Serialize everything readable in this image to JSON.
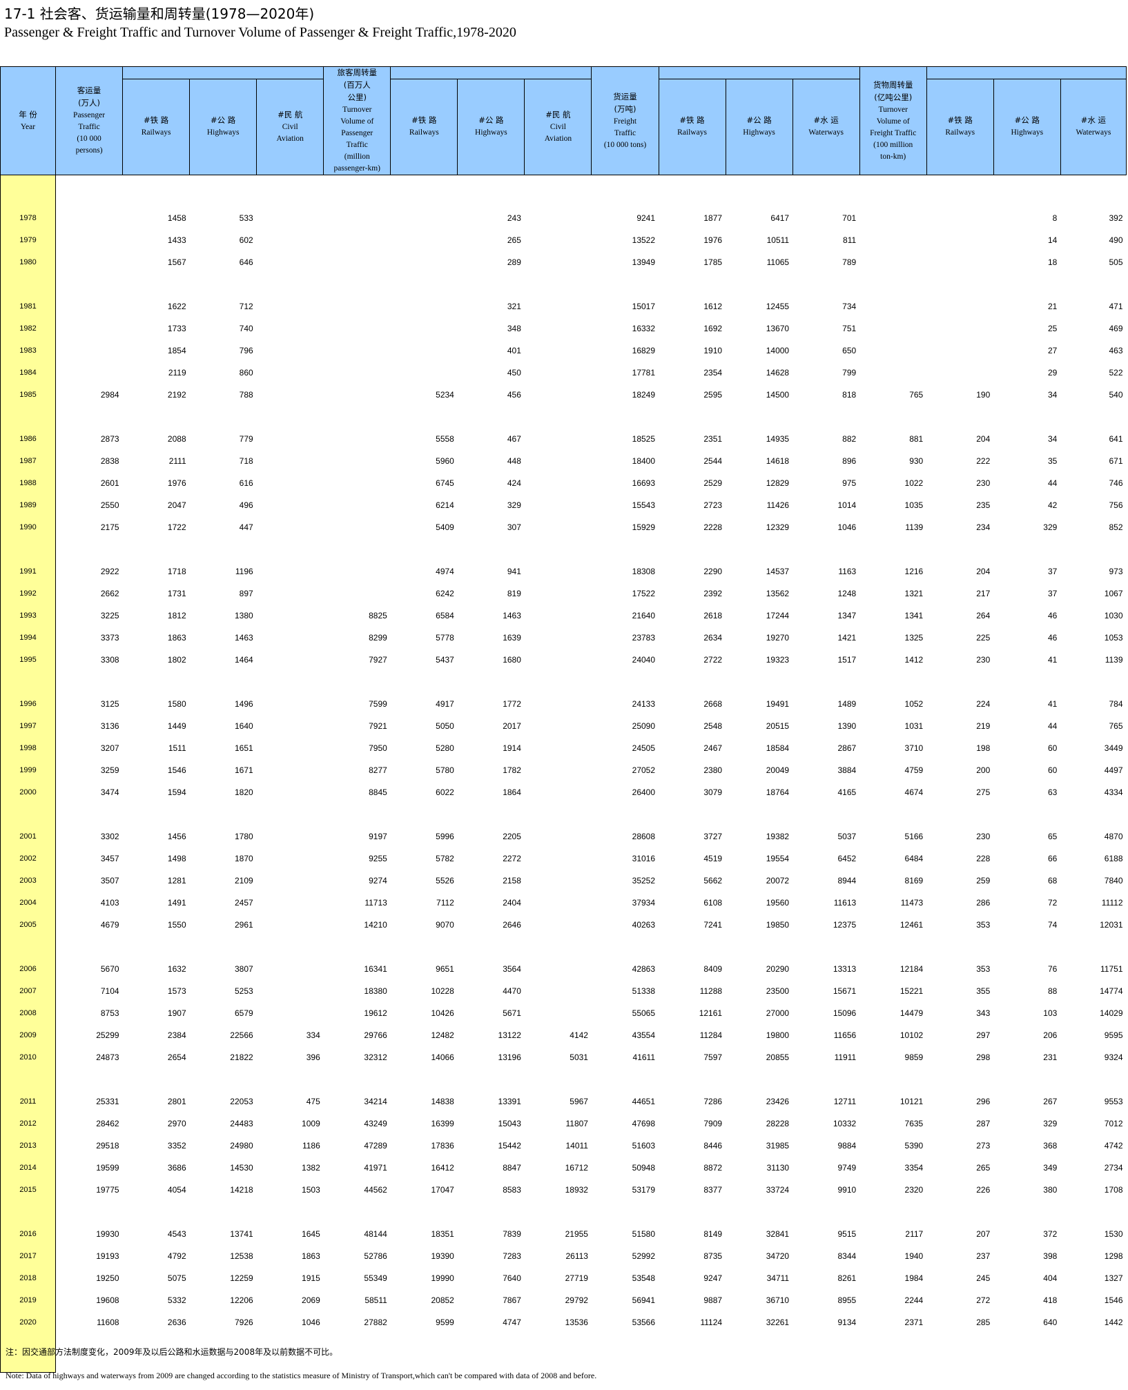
{
  "title_cn": "17-1 社会客、货运输量和周转量(1978—2020年)",
  "title_en": "Passenger & Freight Traffic and Turnover Volume of Passenger & Freight Traffic,1978-2020",
  "headers": {
    "year": [
      "年 份",
      "Year"
    ],
    "pass_traffic": [
      "客运量",
      "(万人)",
      "Passenger",
      "Traffic",
      "(10 000",
      "persons)"
    ],
    "railways": [
      "#铁 路",
      "Railways"
    ],
    "highways": [
      "#公 路",
      "Highways"
    ],
    "civil": [
      "#民 航",
      "Civil",
      "Aviation"
    ],
    "waterways": [
      "#水 运",
      "Waterways"
    ],
    "pass_turnover": [
      "旅客周转量",
      "(百万人",
      "公里)",
      "Turnover",
      "Volume of",
      "Passenger",
      "Traffic",
      "(million",
      "passenger-km)"
    ],
    "freight_traffic": [
      "货运量",
      "(万吨)",
      "Freight",
      "Traffic",
      "(10 000 tons)"
    ],
    "freight_turnover": [
      "货物周转量",
      "(亿吨公里)",
      "Turnover",
      "Volume of",
      "Freight Traffic",
      "(100 million",
      "ton-km)"
    ]
  },
  "rows": [
    [
      "1978",
      "",
      "1458",
      "533",
      "",
      "",
      "",
      "243",
      "",
      "9241",
      "1877",
      "6417",
      "701",
      "",
      "",
      "8",
      "392"
    ],
    [
      "1979",
      "",
      "1433",
      "602",
      "",
      "",
      "",
      "265",
      "",
      "13522",
      "1976",
      "10511",
      "811",
      "",
      "",
      "14",
      "490"
    ],
    [
      "1980",
      "",
      "1567",
      "646",
      "",
      "",
      "",
      "289",
      "",
      "13949",
      "1785",
      "11065",
      "789",
      "",
      "",
      "18",
      "505"
    ],
    [
      "1981",
      "",
      "1622",
      "712",
      "",
      "",
      "",
      "321",
      "",
      "15017",
      "1612",
      "12455",
      "734",
      "",
      "",
      "21",
      "471"
    ],
    [
      "1982",
      "",
      "1733",
      "740",
      "",
      "",
      "",
      "348",
      "",
      "16332",
      "1692",
      "13670",
      "751",
      "",
      "",
      "25",
      "469"
    ],
    [
      "1983",
      "",
      "1854",
      "796",
      "",
      "",
      "",
      "401",
      "",
      "16829",
      "1910",
      "14000",
      "650",
      "",
      "",
      "27",
      "463"
    ],
    [
      "1984",
      "",
      "2119",
      "860",
      "",
      "",
      "",
      "450",
      "",
      "17781",
      "2354",
      "14628",
      "799",
      "",
      "",
      "29",
      "522"
    ],
    [
      "1985",
      "2984",
      "2192",
      "788",
      "",
      "",
      "5234",
      "456",
      "",
      "18249",
      "2595",
      "14500",
      "818",
      "765",
      "190",
      "34",
      "540"
    ],
    [
      "1986",
      "2873",
      "2088",
      "779",
      "",
      "",
      "5558",
      "467",
      "",
      "18525",
      "2351",
      "14935",
      "882",
      "881",
      "204",
      "34",
      "641"
    ],
    [
      "1987",
      "2838",
      "2111",
      "718",
      "",
      "",
      "5960",
      "448",
      "",
      "18400",
      "2544",
      "14618",
      "896",
      "930",
      "222",
      "35",
      "671"
    ],
    [
      "1988",
      "2601",
      "1976",
      "616",
      "",
      "",
      "6745",
      "424",
      "",
      "16693",
      "2529",
      "12829",
      "975",
      "1022",
      "230",
      "44",
      "746"
    ],
    [
      "1989",
      "2550",
      "2047",
      "496",
      "",
      "",
      "6214",
      "329",
      "",
      "15543",
      "2723",
      "11426",
      "1014",
      "1035",
      "235",
      "42",
      "756"
    ],
    [
      "1990",
      "2175",
      "1722",
      "447",
      "",
      "",
      "5409",
      "307",
      "",
      "15929",
      "2228",
      "12329",
      "1046",
      "1139",
      "234",
      "329",
      "852"
    ],
    [
      "1991",
      "2922",
      "1718",
      "1196",
      "",
      "",
      "4974",
      "941",
      "",
      "18308",
      "2290",
      "14537",
      "1163",
      "1216",
      "204",
      "37",
      "973"
    ],
    [
      "1992",
      "2662",
      "1731",
      "897",
      "",
      "",
      "6242",
      "819",
      "",
      "17522",
      "2392",
      "13562",
      "1248",
      "1321",
      "217",
      "37",
      "1067"
    ],
    [
      "1993",
      "3225",
      "1812",
      "1380",
      "",
      "8825",
      "6584",
      "1463",
      "",
      "21640",
      "2618",
      "17244",
      "1347",
      "1341",
      "264",
      "46",
      "1030"
    ],
    [
      "1994",
      "3373",
      "1863",
      "1463",
      "",
      "8299",
      "5778",
      "1639",
      "",
      "23783",
      "2634",
      "19270",
      "1421",
      "1325",
      "225",
      "46",
      "1053"
    ],
    [
      "1995",
      "3308",
      "1802",
      "1464",
      "",
      "7927",
      "5437",
      "1680",
      "",
      "24040",
      "2722",
      "19323",
      "1517",
      "1412",
      "230",
      "41",
      "1139"
    ],
    [
      "1996",
      "3125",
      "1580",
      "1496",
      "",
      "7599",
      "4917",
      "1772",
      "",
      "24133",
      "2668",
      "19491",
      "1489",
      "1052",
      "224",
      "41",
      "784"
    ],
    [
      "1997",
      "3136",
      "1449",
      "1640",
      "",
      "7921",
      "5050",
      "2017",
      "",
      "25090",
      "2548",
      "20515",
      "1390",
      "1031",
      "219",
      "44",
      "765"
    ],
    [
      "1998",
      "3207",
      "1511",
      "1651",
      "",
      "7950",
      "5280",
      "1914",
      "",
      "24505",
      "2467",
      "18584",
      "2867",
      "3710",
      "198",
      "60",
      "3449"
    ],
    [
      "1999",
      "3259",
      "1546",
      "1671",
      "",
      "8277",
      "5780",
      "1782",
      "",
      "27052",
      "2380",
      "20049",
      "3884",
      "4759",
      "200",
      "60",
      "4497"
    ],
    [
      "2000",
      "3474",
      "1594",
      "1820",
      "",
      "8845",
      "6022",
      "1864",
      "",
      "26400",
      "3079",
      "18764",
      "4165",
      "4674",
      "275",
      "63",
      "4334"
    ],
    [
      "2001",
      "3302",
      "1456",
      "1780",
      "",
      "9197",
      "5996",
      "2205",
      "",
      "28608",
      "3727",
      "19382",
      "5037",
      "5166",
      "230",
      "65",
      "4870"
    ],
    [
      "2002",
      "3457",
      "1498",
      "1870",
      "",
      "9255",
      "5782",
      "2272",
      "",
      "31016",
      "4519",
      "19554",
      "6452",
      "6484",
      "228",
      "66",
      "6188"
    ],
    [
      "2003",
      "3507",
      "1281",
      "2109",
      "",
      "9274",
      "5526",
      "2158",
      "",
      "35252",
      "5662",
      "20072",
      "8944",
      "8169",
      "259",
      "68",
      "7840"
    ],
    [
      "2004",
      "4103",
      "1491",
      "2457",
      "",
      "11713",
      "7112",
      "2404",
      "",
      "37934",
      "6108",
      "19560",
      "11613",
      "11473",
      "286",
      "72",
      "11112"
    ],
    [
      "2005",
      "4679",
      "1550",
      "2961",
      "",
      "14210",
      "9070",
      "2646",
      "",
      "40263",
      "7241",
      "19850",
      "12375",
      "12461",
      "353",
      "74",
      "12031"
    ],
    [
      "2006",
      "5670",
      "1632",
      "3807",
      "",
      "16341",
      "9651",
      "3564",
      "",
      "42863",
      "8409",
      "20290",
      "13313",
      "12184",
      "353",
      "76",
      "11751"
    ],
    [
      "2007",
      "7104",
      "1573",
      "5253",
      "",
      "18380",
      "10228",
      "4470",
      "",
      "51338",
      "11288",
      "23500",
      "15671",
      "15221",
      "355",
      "88",
      "14774"
    ],
    [
      "2008",
      "8753",
      "1907",
      "6579",
      "",
      "19612",
      "10426",
      "5671",
      "",
      "55065",
      "12161",
      "27000",
      "15096",
      "14479",
      "343",
      "103",
      "14029"
    ],
    [
      "2009",
      "25299",
      "2384",
      "22566",
      "334",
      "29766",
      "12482",
      "13122",
      "4142",
      "43554",
      "11284",
      "19800",
      "11656",
      "10102",
      "297",
      "206",
      "9595"
    ],
    [
      "2010",
      "24873",
      "2654",
      "21822",
      "396",
      "32312",
      "14066",
      "13196",
      "5031",
      "41611",
      "7597",
      "20855",
      "11911",
      "9859",
      "298",
      "231",
      "9324"
    ],
    [
      "2011",
      "25331",
      "2801",
      "22053",
      "475",
      "34214",
      "14838",
      "13391",
      "5967",
      "44651",
      "7286",
      "23426",
      "12711",
      "10121",
      "296",
      "267",
      "9553"
    ],
    [
      "2012",
      "28462",
      "2970",
      "24483",
      "1009",
      "43249",
      "16399",
      "15043",
      "11807",
      "47698",
      "7909",
      "28228",
      "10332",
      "7635",
      "287",
      "329",
      "7012"
    ],
    [
      "2013",
      "29518",
      "3352",
      "24980",
      "1186",
      "47289",
      "17836",
      "15442",
      "14011",
      "51603",
      "8446",
      "31985",
      "9884",
      "5390",
      "273",
      "368",
      "4742"
    ],
    [
      "2014",
      "19599",
      "3686",
      "14530",
      "1382",
      "41971",
      "16412",
      "8847",
      "16712",
      "50948",
      "8872",
      "31130",
      "9749",
      "3354",
      "265",
      "349",
      "2734"
    ],
    [
      "2015",
      "19775",
      "4054",
      "14218",
      "1503",
      "44562",
      "17047",
      "8583",
      "18932",
      "53179",
      "8377",
      "33724",
      "9910",
      "2320",
      "226",
      "380",
      "1708"
    ],
    [
      "2016",
      "19930",
      "4543",
      "13741",
      "1645",
      "48144",
      "18351",
      "7839",
      "21955",
      "51580",
      "8149",
      "32841",
      "9515",
      "2117",
      "207",
      "372",
      "1530"
    ],
    [
      "2017",
      "19193",
      "4792",
      "12538",
      "1863",
      "52786",
      "19390",
      "7283",
      "26113",
      "52992",
      "8735",
      "34720",
      "8344",
      "1940",
      "237",
      "398",
      "1298"
    ],
    [
      "2018",
      "19250",
      "5075",
      "12259",
      "1915",
      "55349",
      "19990",
      "7640",
      "27719",
      "53548",
      "9247",
      "34711",
      "8261",
      "1984",
      "245",
      "404",
      "1327"
    ],
    [
      "2019",
      "19608",
      "5332",
      "12206",
      "2069",
      "58511",
      "20852",
      "7867",
      "29792",
      "56941",
      "9887",
      "36710",
      "8955",
      "2244",
      "272",
      "418",
      "1546"
    ],
    [
      "2020",
      "11608",
      "2636",
      "7926",
      "1046",
      "27882",
      "9599",
      "4747",
      "13536",
      "53566",
      "11124",
      "32261",
      "9134",
      "2371",
      "285",
      "640",
      "1442"
    ]
  ],
  "note_cn": "注：因交通部方法制度变化，2009年及以后公路和水运数据与2008年及以前数据不可比。",
  "note_en": "Note: Data of highways and waterways from 2009 are changed according to the statistics measure of Ministry of Transport,which can't be compared with data of 2008 and before."
}
